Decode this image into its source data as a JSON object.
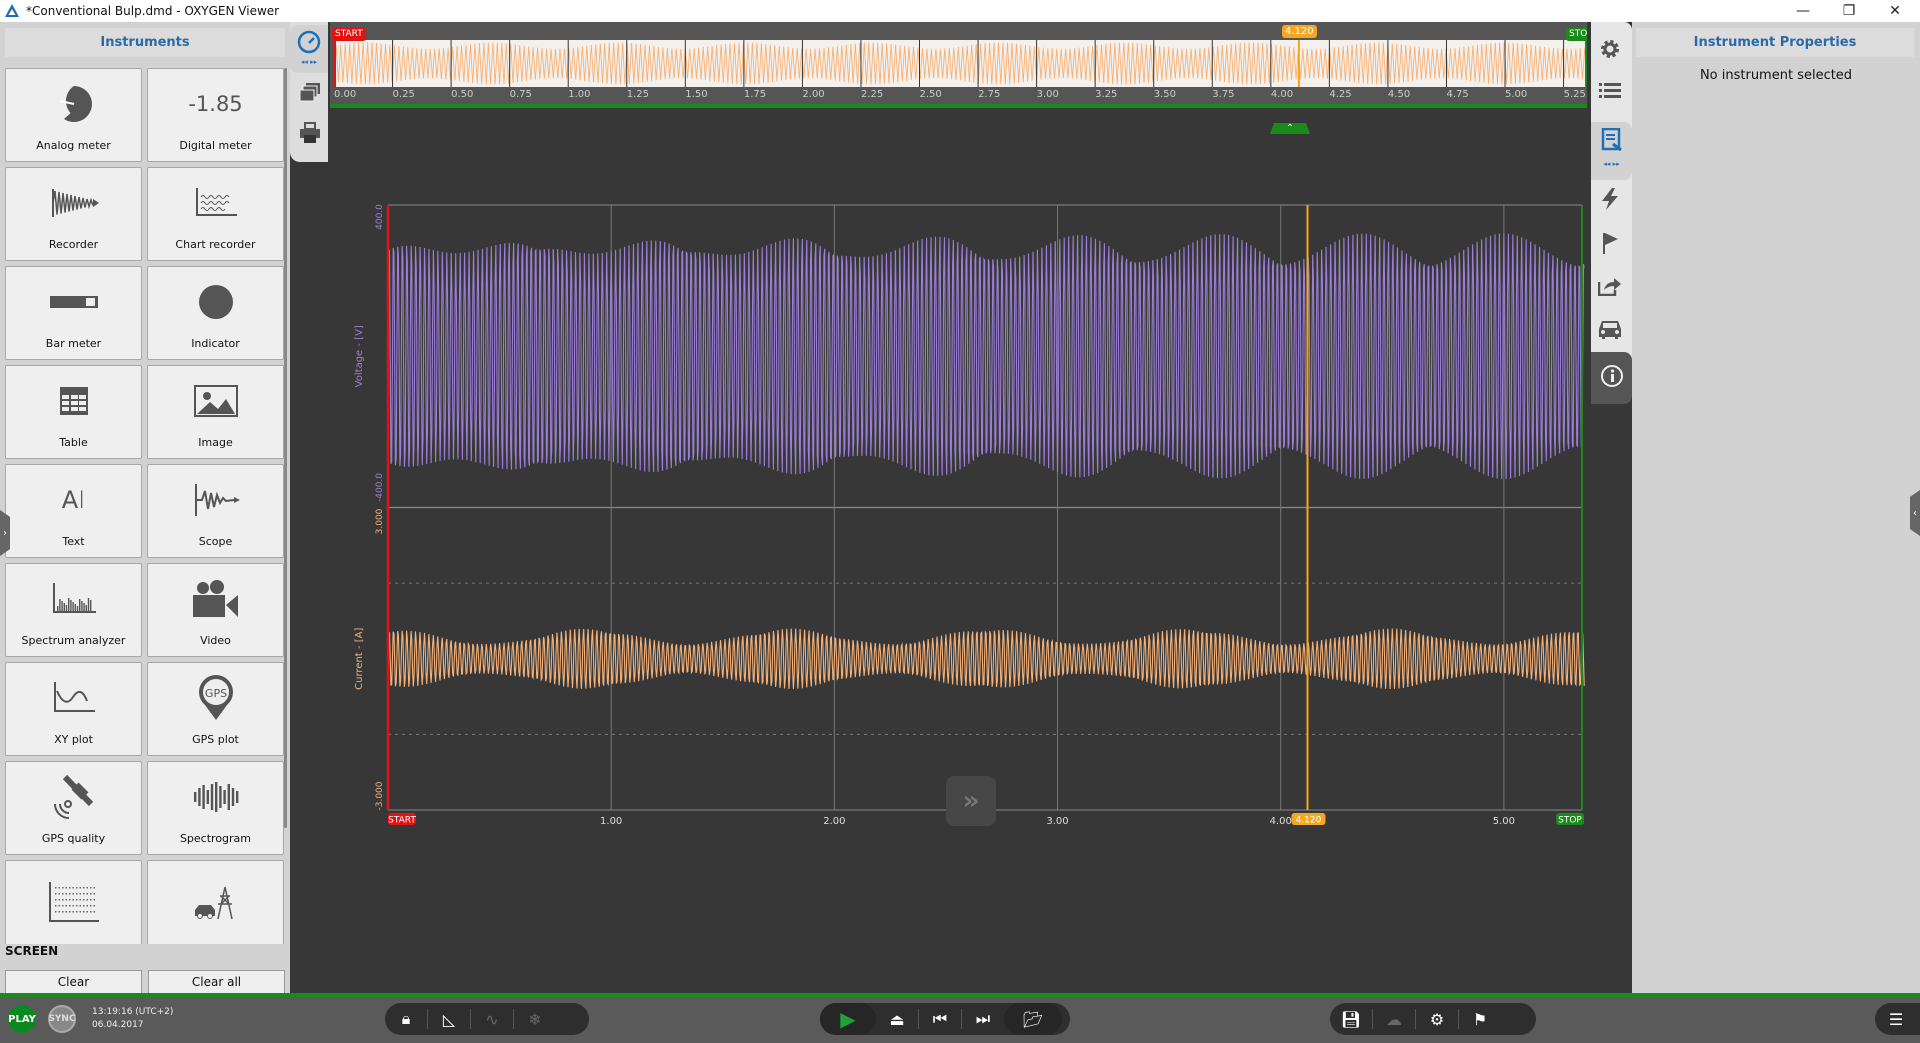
{
  "window": {
    "title": "*Conventional Bulp.dmd - OXYGEN Viewer",
    "controls": [
      "minimize",
      "restore",
      "close"
    ]
  },
  "left_panel": {
    "title": "Instruments",
    "tiles": [
      {
        "label": "Analog meter",
        "icon": "analog-meter-icon"
      },
      {
        "label": "Digital meter",
        "icon": "digital-meter-icon",
        "icon_text": "-1.85"
      },
      {
        "label": "Recorder",
        "icon": "recorder-icon"
      },
      {
        "label": "Chart recorder",
        "icon": "chart-recorder-icon"
      },
      {
        "label": "Bar meter",
        "icon": "bar-meter-icon"
      },
      {
        "label": "Indicator",
        "icon": "indicator-icon"
      },
      {
        "label": "Table",
        "icon": "table-icon"
      },
      {
        "label": "Image",
        "icon": "image-icon"
      },
      {
        "label": "Text",
        "icon": "text-icon",
        "icon_text": "AI"
      },
      {
        "label": "Scope",
        "icon": "scope-icon"
      },
      {
        "label": "Spectrum analyzer",
        "icon": "spectrum-analyzer-icon"
      },
      {
        "label": "Video",
        "icon": "video-camera-icon"
      },
      {
        "label": "XY plot",
        "icon": "xy-plot-icon"
      },
      {
        "label": "GPS plot",
        "icon": "gps-pin-icon",
        "icon_text": "GPS"
      },
      {
        "label": "GPS quality",
        "icon": "satellite-icon"
      },
      {
        "label": "Spectrogram",
        "icon": "spectrogram-icon"
      },
      {
        "label": "",
        "icon": "scatter-grid-icon"
      },
      {
        "label": "",
        "icon": "power-grid-car-icon"
      }
    ],
    "screen_section": "SCREEN",
    "clear_label": "Clear",
    "clear_all_label": "Clear all"
  },
  "overview": {
    "start_label": "START",
    "stop_label": "STOP",
    "cursor_label": "4.120",
    "ticks": [
      "0.00",
      "0.25",
      "0.50",
      "0.75",
      "1.00",
      "1.25",
      "1.50",
      "1.75",
      "2.00",
      "2.25",
      "2.50",
      "2.75",
      "3.00",
      "3.25",
      "3.50",
      "3.75",
      "4.00",
      "4.25",
      "4.50",
      "4.75",
      "5.00",
      "5.25"
    ]
  },
  "chart_data": {
    "type": "line",
    "title": "",
    "xlabel": "",
    "x_ticks": [
      "1.00",
      "2.00",
      "3.00",
      "4.00",
      "5.00"
    ],
    "xlim": [
      0.0,
      5.35
    ],
    "grid": true,
    "cursor": {
      "value": 4.12,
      "label": "4.120",
      "color": "#f5a623"
    },
    "start_marker": {
      "label": "START",
      "color": "#e31212"
    },
    "stop_marker": {
      "label": "STOP",
      "color": "#1a8a1a"
    },
    "series": [
      {
        "name": "Voltage",
        "ylabel": "Voltage - [V]",
        "ylim": [
          -400.0,
          400.0
        ],
        "ymax_label": "400.0",
        "ymin_label": "-400.0",
        "color": "#9b7fd4",
        "amplitude": 325,
        "frequency_hz": 50
      },
      {
        "name": "Current",
        "ylabel": "Current - [A]",
        "ylim": [
          -3.0,
          3.0
        ],
        "ymax_label": "3.000",
        "ymin_label": "-3.000",
        "color": "#f4b27a",
        "amplitude": 0.6,
        "frequency_hz": 50
      }
    ]
  },
  "chart_controls": {
    "fast_forward": "»"
  },
  "right_panel": {
    "title": "Instrument Properties",
    "message": "No instrument selected"
  },
  "left_tabs": [
    "instruments-gauge-icon",
    "screens-icon",
    "print-icon"
  ],
  "right_tabs": [
    "settings-gear-icon",
    "channel-list-icon",
    "report-icon",
    "trigger-lightning-icon",
    "marker-flag-icon",
    "export-icon",
    "car-icon",
    "info-icon"
  ],
  "statusbar": {
    "play_label": "PLAY",
    "sync_label": "SYNC",
    "time": "13:19:16 (UTC+2)",
    "date": "06.04.2017"
  },
  "colors": {
    "accent_blue": "#2b6aa8",
    "play_green": "#0a8a1e",
    "voltage": "#9b7fd4",
    "current": "#f4b27a",
    "cursor": "#f5a623"
  }
}
